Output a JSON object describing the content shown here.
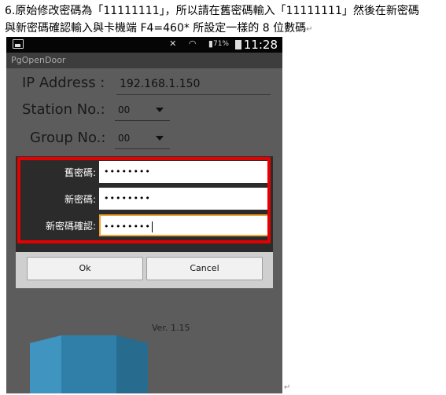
{
  "instruction": {
    "line1": "6.原始修改密碼為「11111111」，所以請在舊密碼輸入「11111111」然後在新密碼",
    "line2": "與新密碼確認輸入與卡機端 F4=460* 所設定一樣的 8 位數碼"
  },
  "statusbar": {
    "battery_pct": "71%",
    "time": "11:28"
  },
  "app": {
    "title": "PgOpenDoor",
    "ip_label": "IP Address :",
    "ip_value": "192.168.1.150",
    "station_label": "Station No.:",
    "station_value": "00",
    "group_label": "Group No.:",
    "group_value": "00",
    "version": "Ver. 1.15"
  },
  "dialog": {
    "old_pwd_label": "舊密碼:",
    "old_pwd_value": "••••••••",
    "new_pwd_label": "新密碼:",
    "new_pwd_value": "••••••••",
    "confirm_label": "新密碼確認:",
    "confirm_value": "••••••••",
    "ok_label": "Ok",
    "cancel_label": "Cancel"
  },
  "colors": {
    "highlight": "#e60000",
    "focus_border": "#f2a533",
    "graphic_blue": "#2f7fa8"
  }
}
